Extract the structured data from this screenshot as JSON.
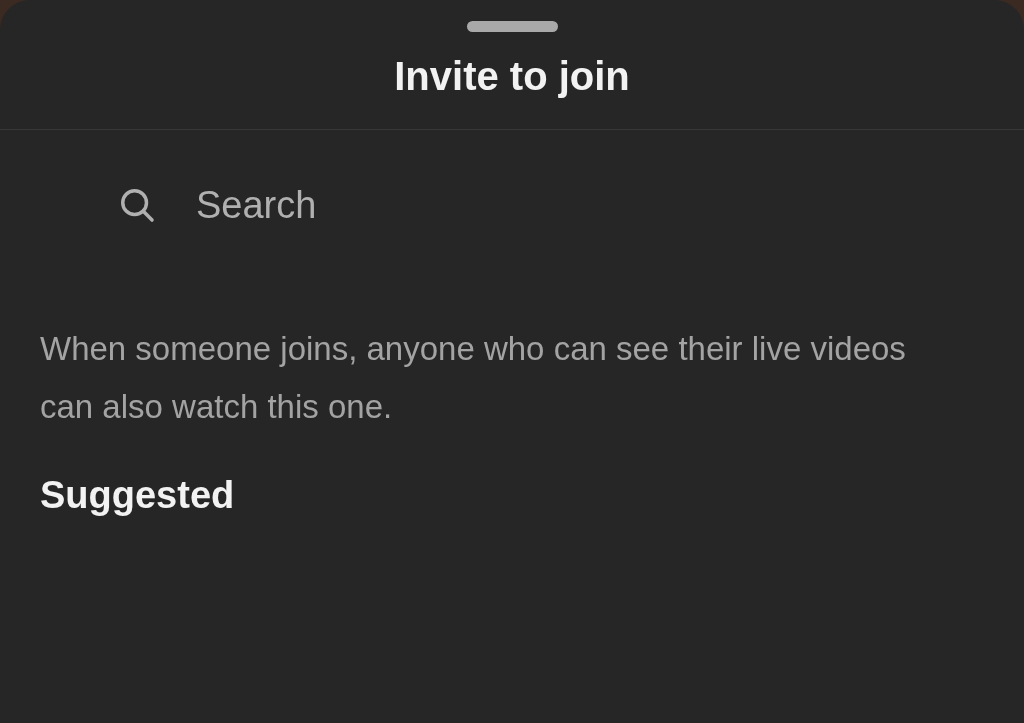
{
  "sheet": {
    "title": "Invite to join"
  },
  "search": {
    "placeholder": "Search"
  },
  "notice": "When someone joins, anyone who can see their live videos can also watch this one.",
  "section_heading": "Suggested"
}
